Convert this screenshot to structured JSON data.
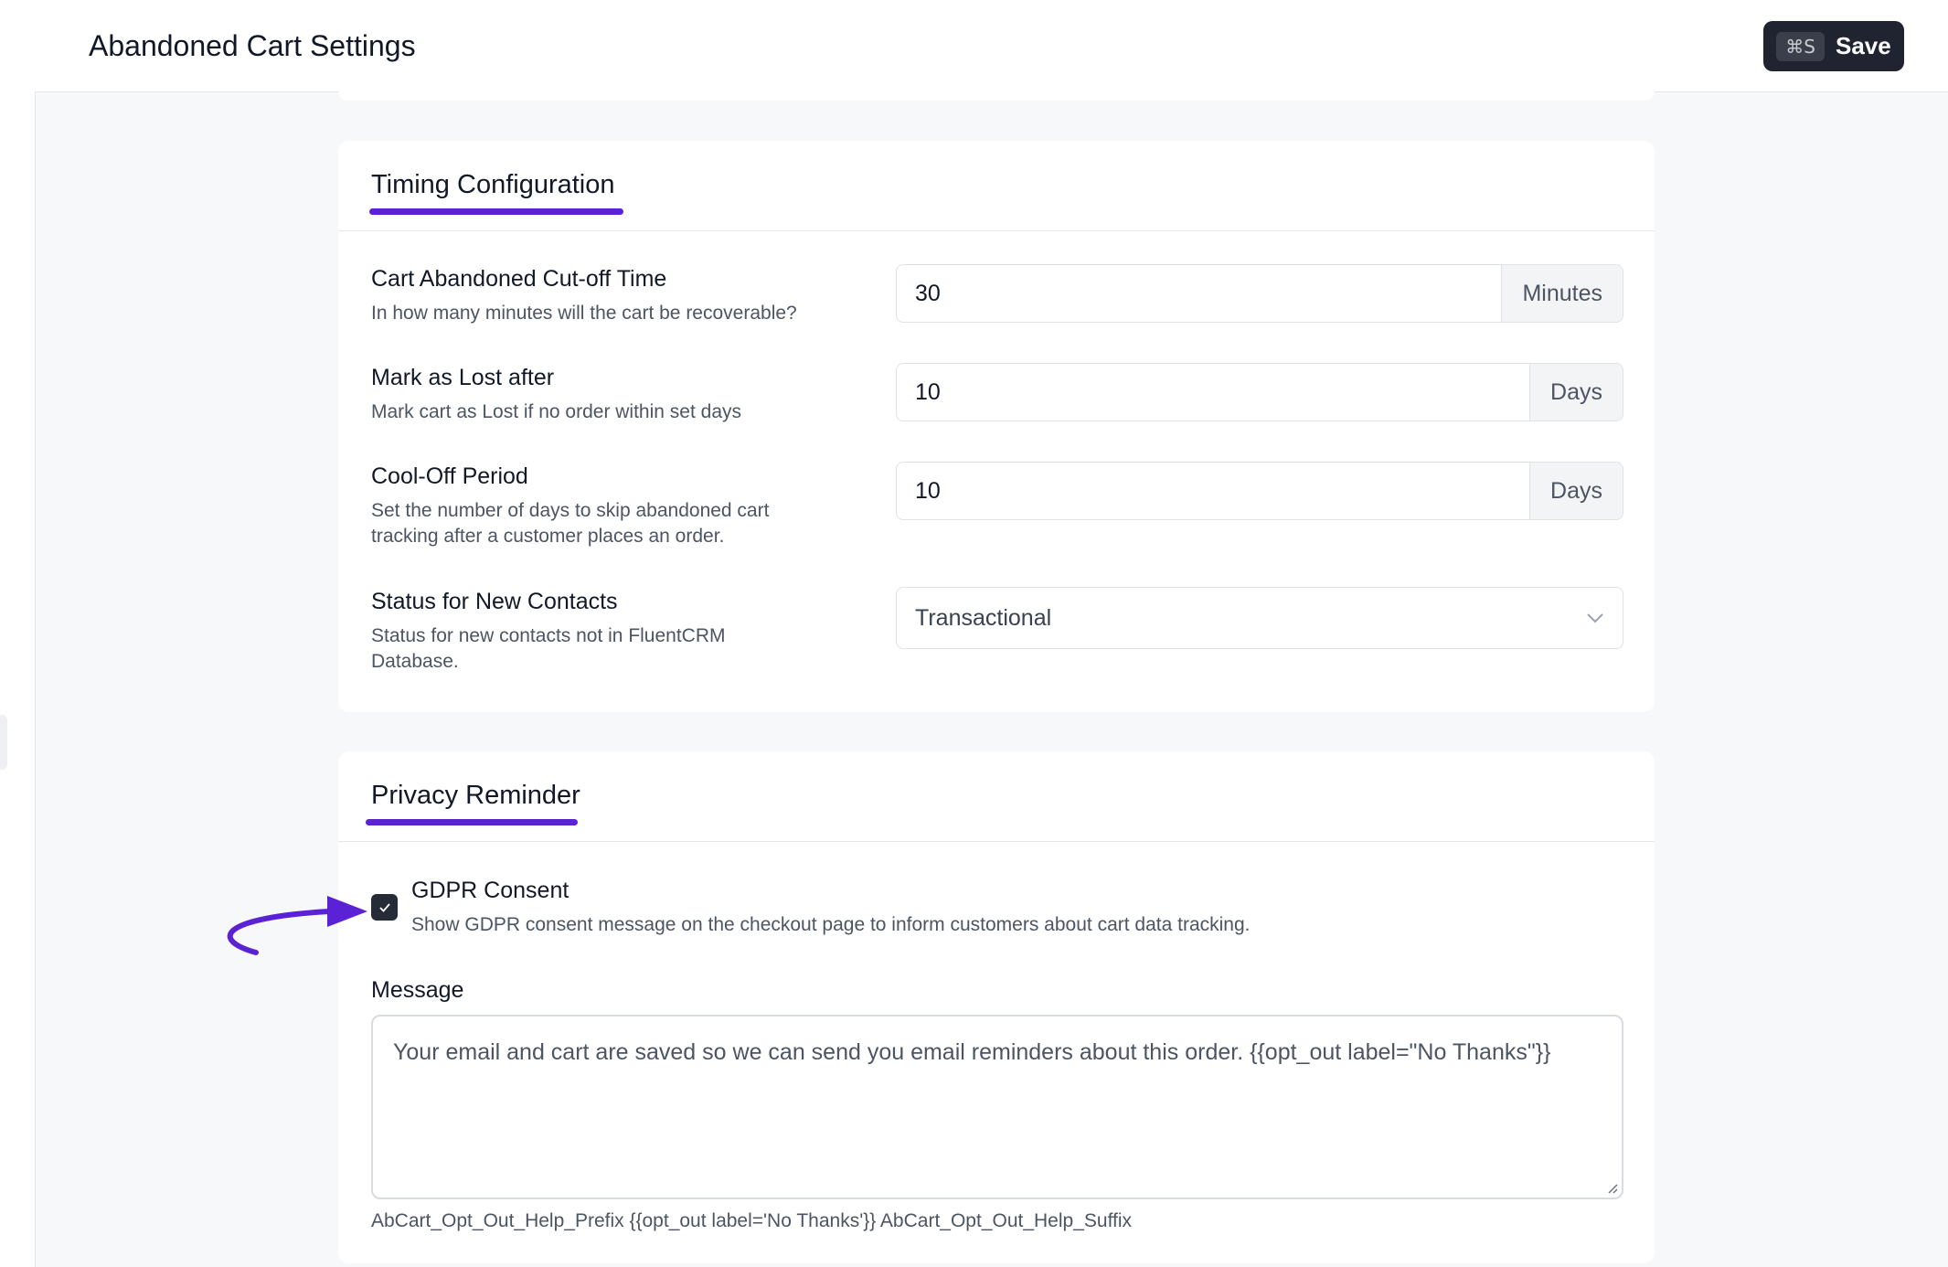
{
  "header": {
    "title": "Abandoned Cart Settings",
    "save_shortcut": "⌘S",
    "save_label": "Save"
  },
  "timing": {
    "title": "Timing Configuration",
    "fields": [
      {
        "label": "Cart Abandoned Cut-off Time",
        "desc": "In how many minutes will the cart be recoverable?",
        "value": "30",
        "unit": "Minutes"
      },
      {
        "label": "Mark as Lost after",
        "desc": "Mark cart as Lost if no order within set days",
        "value": "10",
        "unit": "Days"
      },
      {
        "label": "Cool-Off Period",
        "desc": "Set the number of days to skip abandoned cart tracking after a customer places an order.",
        "value": "10",
        "unit": "Days"
      }
    ],
    "status": {
      "label": "Status for New Contacts",
      "desc": "Status for new contacts not in FluentCRM Database.",
      "selected": "Transactional"
    }
  },
  "privacy": {
    "title": "Privacy Reminder",
    "gdpr": {
      "label": "GDPR Consent",
      "desc": "Show GDPR consent message on the checkout page to inform customers about cart data tracking.",
      "checked": true
    },
    "message": {
      "label": "Message",
      "value": "Your email and cart are saved so we can send you email reminders about this order. {{opt_out label=\"No Thanks\"}}"
    },
    "help": "AbCart_Opt_Out_Help_Prefix {{opt_out label='No Thanks'}} AbCart_Opt_Out_Help_Suffix"
  },
  "colors": {
    "accent": "#5b21d4",
    "save_button": "#1f2430"
  }
}
